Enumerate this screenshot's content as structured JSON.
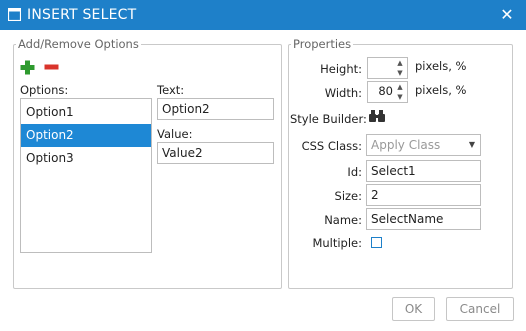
{
  "dialog": {
    "title": "INSERT SELECT",
    "title_icon": "window-icon",
    "close_icon": "close-icon",
    "close_glyph": "✕"
  },
  "options_panel": {
    "legend": "Add/Remove Options",
    "add_icon": "plus-icon",
    "remove_icon": "minus-icon",
    "options_label": "Options:",
    "options": [
      "Option1",
      "Option2",
      "Option3"
    ],
    "selected_option": "Option2",
    "text_label": "Text:",
    "text_value": "Option2",
    "value_label": "Value:",
    "value_value": "Value2"
  },
  "properties_panel": {
    "legend": "Properties",
    "height_label": "Height:",
    "height_value": "",
    "height_unit": "pixels, %",
    "width_label": "Width:",
    "width_value": "80",
    "width_unit": "pixels, %",
    "style_builder_label": "Style Builder:",
    "style_builder_icon": "binoculars-icon",
    "css_class_label": "CSS Class:",
    "css_class_placeholder": "Apply Class",
    "id_label": "Id:",
    "id_value": "Select1",
    "size_label": "Size:",
    "size_value": "2",
    "name_label": "Name:",
    "name_value": "SelectName",
    "multiple_label": "Multiple:",
    "multiple_checked": false
  },
  "footer": {
    "ok_label": "OK",
    "cancel_label": "Cancel"
  },
  "colors": {
    "titlebar": "#1e80c9",
    "selection": "#1e88d5",
    "add_icon": "#2e9a2e",
    "remove_icon": "#d9342b"
  }
}
